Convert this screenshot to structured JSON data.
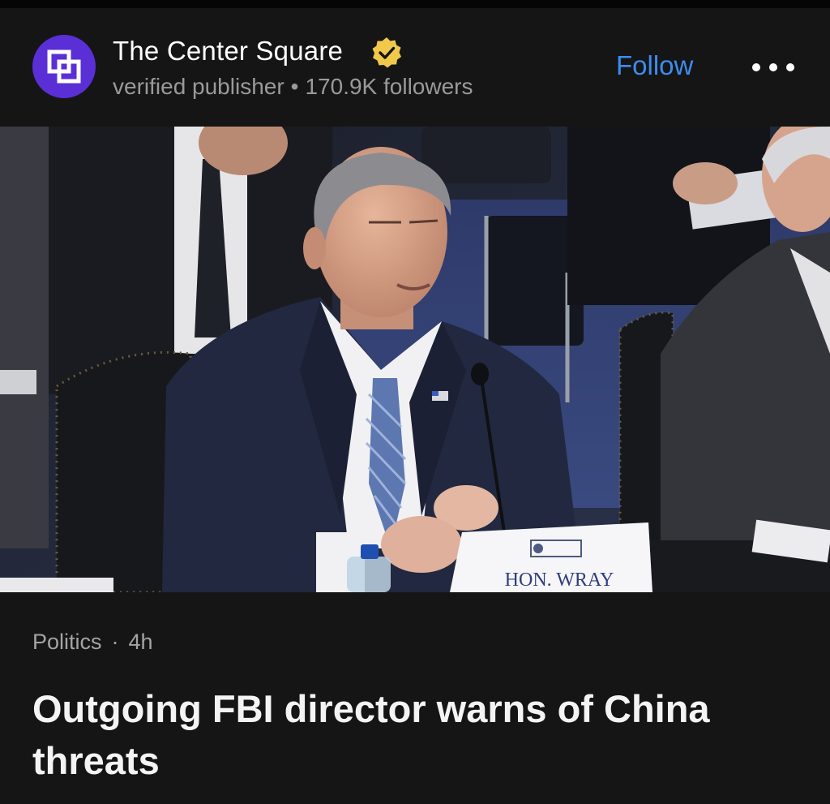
{
  "publisher": {
    "name": "The Center Square",
    "verified_label": "verified publisher",
    "separator": "•",
    "followers": "170.9K followers",
    "follow_label": "Follow",
    "avatar_icon": "overlapping-squares-logo",
    "brand_color": "#5a2fd6",
    "badge_color": "#f0c94a"
  },
  "photo": {
    "nameplate_text": "HON. WRAY"
  },
  "article": {
    "category": "Politics",
    "separator": "·",
    "age": "4h",
    "headline": "Outgoing FBI director warns of China threats"
  },
  "colors": {
    "background": "#151515",
    "follow": "#3d8cf0",
    "meta": "#9a9a9a"
  }
}
